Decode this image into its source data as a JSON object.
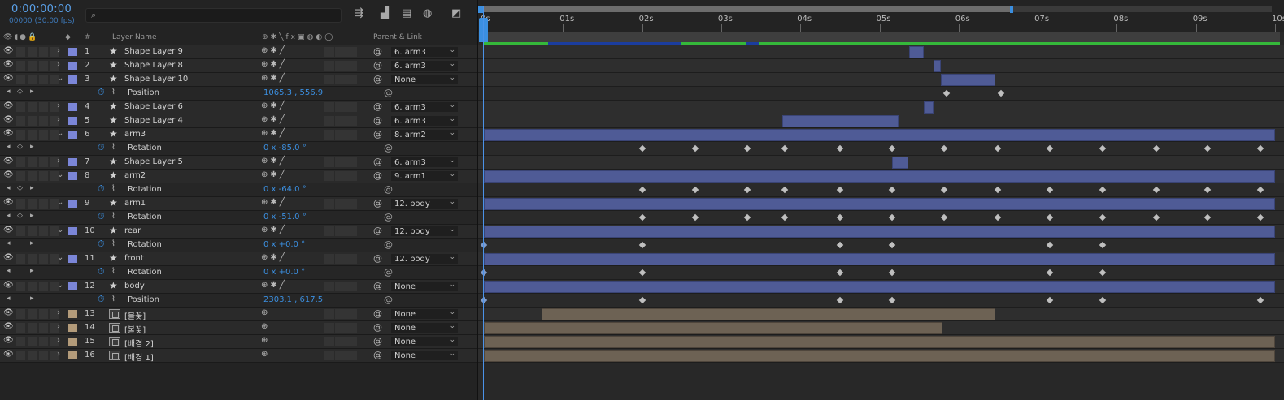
{
  "timecode": "0:00:00:00",
  "frames": "00000 (30.00 fps)",
  "search_placeholder": "",
  "columns": {
    "layer_name": "Layer Name",
    "parent": "Parent & Link",
    "hash": "#"
  },
  "ruler": [
    "0s",
    "01s",
    "02s",
    "03s",
    "04s",
    "05s",
    "06s",
    "07s",
    "08s",
    "09s",
    "10s"
  ],
  "layers": [
    {
      "num": "1",
      "name": "Shape Layer 9",
      "type": "shape",
      "parent": "6. arm3",
      "expanded": false
    },
    {
      "num": "2",
      "name": "Shape Layer 8",
      "type": "shape",
      "parent": "6. arm3",
      "expanded": false
    },
    {
      "num": "3",
      "name": "Shape Layer 10",
      "type": "shape",
      "parent": "None",
      "expanded": true
    },
    {
      "prop": "Position",
      "value": "1065.3 , 556.9"
    },
    {
      "num": "4",
      "name": "Shape Layer 6",
      "type": "shape",
      "parent": "6. arm3",
      "expanded": false
    },
    {
      "num": "5",
      "name": "Shape Layer 4",
      "type": "shape",
      "parent": "6. arm3",
      "expanded": false
    },
    {
      "num": "6",
      "name": "arm3",
      "type": "shape",
      "parent": "8. arm2",
      "expanded": true
    },
    {
      "prop": "Rotation",
      "value": "0 x -85.0 °"
    },
    {
      "num": "7",
      "name": "Shape Layer 5",
      "type": "shape",
      "parent": "6. arm3",
      "expanded": false
    },
    {
      "num": "8",
      "name": "arm2",
      "type": "shape",
      "parent": "9. arm1",
      "expanded": true
    },
    {
      "prop": "Rotation",
      "value": "0 x -64.0 °"
    },
    {
      "num": "9",
      "name": "arm1",
      "type": "shape",
      "parent": "12. body",
      "expanded": true
    },
    {
      "prop": "Rotation",
      "value": "0 x -51.0 °"
    },
    {
      "num": "10",
      "name": "rear",
      "type": "shape",
      "parent": "12. body",
      "expanded": true
    },
    {
      "prop": "Rotation",
      "value": "0 x +0.0 °"
    },
    {
      "num": "11",
      "name": "front",
      "type": "shape",
      "parent": "12. body",
      "expanded": true
    },
    {
      "prop": "Rotation",
      "value": "0 x +0.0 °"
    },
    {
      "num": "12",
      "name": "body",
      "type": "shape",
      "parent": "None",
      "expanded": true
    },
    {
      "prop": "Position",
      "value": "2303.1 , 617.5"
    },
    {
      "num": "13",
      "name": "[불꽃]",
      "type": "footage",
      "parent": "None",
      "expanded": false
    },
    {
      "num": "14",
      "name": "[불꽃]",
      "type": "footage",
      "parent": "None",
      "expanded": false
    },
    {
      "num": "15",
      "name": "[배경 2]",
      "type": "footage",
      "parent": "None",
      "expanded": false
    },
    {
      "num": "16",
      "name": "[배경 1]",
      "type": "footage",
      "parent": "None",
      "expanded": false
    }
  ],
  "icons": {
    "eye": "eye-icon",
    "star": "shape-star-icon",
    "stopwatch": "stopwatch-icon",
    "pickwhip": "pickwhip-icon"
  },
  "colors": {
    "accent": "#3b8fe0",
    "layer_bar": "#4f5b96",
    "footage_bar": "#6d6254",
    "label_shape": "#7b86d8",
    "label_footage": "#b39b7a"
  }
}
